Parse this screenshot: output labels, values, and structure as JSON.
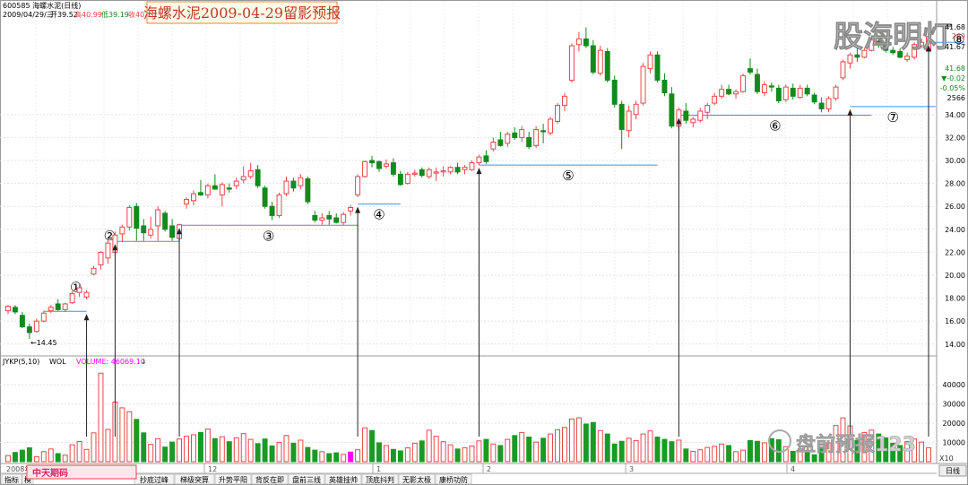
{
  "header": {
    "code_line": "600585 海螺水泥(日线)",
    "date_line": "2009/04/29/三",
    "open": "开39.52",
    "high": "高40.99",
    "low": "低39.19",
    "close": "收40.8"
  },
  "title_box": "海螺水泥2009-04-29留影预报",
  "watermark_top": "股海明灯",
  "watermark_bottom": "盘前预报123",
  "right_info": {
    "v1": "41.68",
    "v2": "249",
    "v3": "41.67",
    "v4": "41.68",
    "change": "▼-0.02",
    "pct": "-0.05%",
    "vol": "2566"
  },
  "low_label": "←14.45",
  "indicator_bar": {
    "label": "JYKP(5,10)",
    "wol": "WOL",
    "vol_label": "VOLUME: 46069.10",
    "arrow": "↓"
  },
  "time_labels": [
    "2008年",
    "12",
    "1",
    "2",
    "3",
    "4"
  ],
  "tabs": [
    "指标",
    "模",
    "抄底过峰",
    "梯级突算",
    "升势平阳",
    "背反在即",
    "盘前三线",
    "英雄挂帅",
    "顶底抖判",
    "无影太极",
    "康桥功防"
  ],
  "bottom_banner": "中天期码",
  "bottom_right_tab": "日线",
  "x10_label": "X10",
  "colors": {
    "up": "#e8464c",
    "down": "#138a1c",
    "level": "#4a90d9",
    "vol_up": "#f3a0a0",
    "vol_down": "#1a9a24",
    "highlight": "#ff00ff"
  },
  "chart_data": {
    "type": "candlestick",
    "price_axis": {
      "ticks": [
        14.0,
        16.0,
        18.0,
        20.0,
        22.0,
        24.0,
        26.0,
        28.0,
        30.0,
        32.0,
        34.0
      ],
      "ylim": [
        13.2,
        41.8
      ]
    },
    "volume_axis": {
      "ticks": [
        10000,
        20000,
        30000,
        40000
      ],
      "ylim": [
        0,
        48000
      ]
    },
    "candles": [
      {
        "o": 16.9,
        "h": 17.4,
        "l": 16.6,
        "c": 17.3
      },
      {
        "o": 17.2,
        "h": 17.4,
        "l": 16.6,
        "c": 16.8
      },
      {
        "o": 16.5,
        "h": 16.8,
        "l": 15.4,
        "c": 15.5
      },
      {
        "o": 15.5,
        "h": 15.8,
        "l": 14.45,
        "c": 15.0
      },
      {
        "o": 15.1,
        "h": 16.2,
        "l": 15.0,
        "c": 16.0
      },
      {
        "o": 16.0,
        "h": 16.9,
        "l": 15.9,
        "c": 16.7
      },
      {
        "o": 16.9,
        "h": 17.4,
        "l": 16.7,
        "c": 17.2
      },
      {
        "o": 17.5,
        "h": 17.9,
        "l": 16.9,
        "c": 17.0
      },
      {
        "o": 17.0,
        "h": 17.6,
        "l": 16.8,
        "c": 17.5
      },
      {
        "o": 17.6,
        "h": 18.6,
        "l": 17.5,
        "c": 18.4
      },
      {
        "o": 18.5,
        "h": 19.2,
        "l": 18.1,
        "c": 18.9
      },
      {
        "o": 18.1,
        "h": 18.7,
        "l": 17.9,
        "c": 18.5
      },
      {
        "o": 20.1,
        "h": 20.8,
        "l": 20.0,
        "c": 20.6
      },
      {
        "o": 20.9,
        "h": 22.1,
        "l": 20.5,
        "c": 22.0
      },
      {
        "o": 21.5,
        "h": 23.2,
        "l": 21.0,
        "c": 22.8
      },
      {
        "o": 22.0,
        "h": 23.8,
        "l": 21.7,
        "c": 23.5
      },
      {
        "o": 23.6,
        "h": 24.4,
        "l": 22.9,
        "c": 24.2
      },
      {
        "o": 24.2,
        "h": 26.1,
        "l": 23.9,
        "c": 25.9
      },
      {
        "o": 26.0,
        "h": 26.3,
        "l": 23.0,
        "c": 24.1
      },
      {
        "o": 24.3,
        "h": 24.9,
        "l": 23.0,
        "c": 23.7
      },
      {
        "o": 23.5,
        "h": 25.1,
        "l": 23.2,
        "c": 24.0
      },
      {
        "o": 24.3,
        "h": 26.0,
        "l": 23.0,
        "c": 25.7
      },
      {
        "o": 25.4,
        "h": 25.6,
        "l": 23.8,
        "c": 24.0
      },
      {
        "o": 24.3,
        "h": 24.9,
        "l": 23.0,
        "c": 23.3
      },
      {
        "o": 23.2,
        "h": 24.5,
        "l": 22.9,
        "c": 24.4
      },
      {
        "o": 26.2,
        "h": 26.8,
        "l": 25.8,
        "c": 26.6
      },
      {
        "o": 26.5,
        "h": 27.4,
        "l": 26.1,
        "c": 27.1
      },
      {
        "o": 27.2,
        "h": 28.3,
        "l": 26.9,
        "c": 27.0
      },
      {
        "o": 27.0,
        "h": 28.0,
        "l": 26.7,
        "c": 27.8
      },
      {
        "o": 27.8,
        "h": 28.8,
        "l": 27.5,
        "c": 27.5
      },
      {
        "o": 27.0,
        "h": 28.1,
        "l": 26.0,
        "c": 27.9
      },
      {
        "o": 27.6,
        "h": 28.0,
        "l": 27.2,
        "c": 27.5
      },
      {
        "o": 27.8,
        "h": 28.5,
        "l": 27.5,
        "c": 28.2
      },
      {
        "o": 28.3,
        "h": 29.5,
        "l": 28.0,
        "c": 28.6
      },
      {
        "o": 28.6,
        "h": 29.8,
        "l": 28.4,
        "c": 29.1
      },
      {
        "o": 29.2,
        "h": 29.6,
        "l": 27.6,
        "c": 27.8
      },
      {
        "o": 27.6,
        "h": 27.8,
        "l": 25.8,
        "c": 26.0
      },
      {
        "o": 26.0,
        "h": 26.4,
        "l": 24.8,
        "c": 25.2
      },
      {
        "o": 25.2,
        "h": 27.2,
        "l": 25.0,
        "c": 27.0
      },
      {
        "o": 27.1,
        "h": 28.6,
        "l": 26.9,
        "c": 28.2
      },
      {
        "o": 28.2,
        "h": 28.5,
        "l": 27.3,
        "c": 27.6
      },
      {
        "o": 27.8,
        "h": 28.8,
        "l": 27.5,
        "c": 28.5
      },
      {
        "o": 28.4,
        "h": 28.6,
        "l": 26.2,
        "c": 26.4
      },
      {
        "o": 25.2,
        "h": 25.6,
        "l": 24.6,
        "c": 24.8
      },
      {
        "o": 24.8,
        "h": 25.4,
        "l": 24.4,
        "c": 25.0
      },
      {
        "o": 25.2,
        "h": 25.6,
        "l": 24.4,
        "c": 24.9
      },
      {
        "o": 25.0,
        "h": 25.4,
        "l": 24.5,
        "c": 24.6
      },
      {
        "o": 24.6,
        "h": 25.5,
        "l": 24.4,
        "c": 25.3
      },
      {
        "o": 25.6,
        "h": 26.1,
        "l": 25.2,
        "c": 25.9
      },
      {
        "o": 27.0,
        "h": 28.8,
        "l": 26.8,
        "c": 28.6
      },
      {
        "o": 28.6,
        "h": 30.0,
        "l": 28.5,
        "c": 29.9
      },
      {
        "o": 30.0,
        "h": 30.4,
        "l": 29.4,
        "c": 29.8
      },
      {
        "o": 29.9,
        "h": 30.0,
        "l": 29.0,
        "c": 29.3
      },
      {
        "o": 29.5,
        "h": 30.1,
        "l": 29.3,
        "c": 29.7
      },
      {
        "o": 29.8,
        "h": 30.2,
        "l": 28.6,
        "c": 28.8
      },
      {
        "o": 28.8,
        "h": 29.1,
        "l": 27.8,
        "c": 27.9
      },
      {
        "o": 28.0,
        "h": 29.0,
        "l": 27.9,
        "c": 28.8
      },
      {
        "o": 28.8,
        "h": 29.2,
        "l": 28.6,
        "c": 28.9
      },
      {
        "o": 29.2,
        "h": 29.4,
        "l": 28.5,
        "c": 28.7
      },
      {
        "o": 28.6,
        "h": 29.4,
        "l": 28.4,
        "c": 29.2
      },
      {
        "o": 28.9,
        "h": 29.4,
        "l": 28.2,
        "c": 29.0
      },
      {
        "o": 29.0,
        "h": 29.5,
        "l": 28.6,
        "c": 29.1
      },
      {
        "o": 29.0,
        "h": 29.5,
        "l": 28.8,
        "c": 29.4
      },
      {
        "o": 29.4,
        "h": 29.8,
        "l": 28.8,
        "c": 29.0
      },
      {
        "o": 29.2,
        "h": 29.6,
        "l": 28.8,
        "c": 29.4
      },
      {
        "o": 29.2,
        "h": 30.0,
        "l": 29.1,
        "c": 29.8
      },
      {
        "o": 29.8,
        "h": 30.5,
        "l": 29.6,
        "c": 30.3
      },
      {
        "o": 30.4,
        "h": 30.9,
        "l": 29.7,
        "c": 29.9
      },
      {
        "o": 31.0,
        "h": 32.0,
        "l": 30.8,
        "c": 31.6
      },
      {
        "o": 31.8,
        "h": 32.5,
        "l": 31.2,
        "c": 31.3
      },
      {
        "o": 31.5,
        "h": 32.5,
        "l": 31.2,
        "c": 32.3
      },
      {
        "o": 32.4,
        "h": 32.9,
        "l": 31.8,
        "c": 32.0
      },
      {
        "o": 32.0,
        "h": 33.0,
        "l": 31.6,
        "c": 32.7
      },
      {
        "o": 32.0,
        "h": 32.5,
        "l": 31.0,
        "c": 31.2
      },
      {
        "o": 31.3,
        "h": 33.0,
        "l": 31.1,
        "c": 32.7
      },
      {
        "o": 32.6,
        "h": 33.2,
        "l": 31.5,
        "c": 32.5
      },
      {
        "o": 32.4,
        "h": 33.8,
        "l": 32.2,
        "c": 33.6
      },
      {
        "o": 33.4,
        "h": 35.0,
        "l": 33.2,
        "c": 34.8
      },
      {
        "o": 34.8,
        "h": 35.9,
        "l": 34.3,
        "c": 35.6
      },
      {
        "o": 37.0,
        "h": 40.2,
        "l": 36.8,
        "c": 40.0
      },
      {
        "o": 40.1,
        "h": 41.2,
        "l": 39.5,
        "c": 40.6
      },
      {
        "o": 40.6,
        "h": 41.6,
        "l": 39.8,
        "c": 40.0
      },
      {
        "o": 40.0,
        "h": 40.5,
        "l": 37.5,
        "c": 37.7
      },
      {
        "o": 37.6,
        "h": 40.0,
        "l": 37.4,
        "c": 39.6
      },
      {
        "o": 39.5,
        "h": 39.8,
        "l": 36.8,
        "c": 37.0
      },
      {
        "o": 37.0,
        "h": 37.4,
        "l": 34.6,
        "c": 34.9
      },
      {
        "o": 34.9,
        "h": 35.2,
        "l": 31.0,
        "c": 32.7
      },
      {
        "o": 32.6,
        "h": 34.8,
        "l": 32.0,
        "c": 34.3
      },
      {
        "o": 34.0,
        "h": 35.2,
        "l": 33.6,
        "c": 34.9
      },
      {
        "o": 35.0,
        "h": 38.5,
        "l": 34.8,
        "c": 38.2
      },
      {
        "o": 38.0,
        "h": 39.5,
        "l": 37.6,
        "c": 39.2
      },
      {
        "o": 39.2,
        "h": 39.5,
        "l": 36.8,
        "c": 37.0
      },
      {
        "o": 37.0,
        "h": 37.6,
        "l": 35.6,
        "c": 35.9
      },
      {
        "o": 35.8,
        "h": 36.4,
        "l": 32.8,
        "c": 33.0
      },
      {
        "o": 33.0,
        "h": 34.6,
        "l": 32.6,
        "c": 34.4
      },
      {
        "o": 34.3,
        "h": 35.0,
        "l": 33.2,
        "c": 33.5
      },
      {
        "o": 33.3,
        "h": 33.8,
        "l": 32.9,
        "c": 33.6
      },
      {
        "o": 33.5,
        "h": 34.6,
        "l": 33.3,
        "c": 34.3
      },
      {
        "o": 34.2,
        "h": 35.0,
        "l": 33.6,
        "c": 34.8
      },
      {
        "o": 35.0,
        "h": 35.9,
        "l": 34.8,
        "c": 35.6
      },
      {
        "o": 35.6,
        "h": 36.6,
        "l": 35.4,
        "c": 36.2
      },
      {
        "o": 36.2,
        "h": 36.6,
        "l": 35.7,
        "c": 35.8
      },
      {
        "o": 35.8,
        "h": 36.2,
        "l": 35.4,
        "c": 36.0
      },
      {
        "o": 36.0,
        "h": 37.6,
        "l": 35.9,
        "c": 37.4
      },
      {
        "o": 38.0,
        "h": 38.9,
        "l": 37.5,
        "c": 37.7
      },
      {
        "o": 37.5,
        "h": 38.0,
        "l": 35.8,
        "c": 36.0
      },
      {
        "o": 35.9,
        "h": 36.9,
        "l": 35.6,
        "c": 36.6
      },
      {
        "o": 36.5,
        "h": 36.8,
        "l": 36.0,
        "c": 36.4
      },
      {
        "o": 36.3,
        "h": 36.6,
        "l": 35.0,
        "c": 35.2
      },
      {
        "o": 35.3,
        "h": 36.6,
        "l": 35.1,
        "c": 36.4
      },
      {
        "o": 36.3,
        "h": 36.7,
        "l": 35.3,
        "c": 35.6
      },
      {
        "o": 35.5,
        "h": 36.6,
        "l": 35.4,
        "c": 36.3
      },
      {
        "o": 36.3,
        "h": 36.6,
        "l": 35.6,
        "c": 35.8
      },
      {
        "o": 35.7,
        "h": 35.9,
        "l": 34.9,
        "c": 35.1
      },
      {
        "o": 35.0,
        "h": 35.5,
        "l": 34.2,
        "c": 34.5
      },
      {
        "o": 34.5,
        "h": 35.6,
        "l": 34.2,
        "c": 35.4
      },
      {
        "o": 35.4,
        "h": 36.6,
        "l": 35.2,
        "c": 36.4
      },
      {
        "o": 37.2,
        "h": 38.8,
        "l": 37.0,
        "c": 38.6
      },
      {
        "o": 38.5,
        "h": 39.4,
        "l": 38.0,
        "c": 39.2
      },
      {
        "o": 39.2,
        "h": 40.0,
        "l": 38.6,
        "c": 39.0
      },
      {
        "o": 39.0,
        "h": 39.8,
        "l": 38.9,
        "c": 39.6
      },
      {
        "o": 39.6,
        "h": 40.8,
        "l": 39.5,
        "c": 40.5
      },
      {
        "o": 40.4,
        "h": 40.7,
        "l": 39.8,
        "c": 40.1
      },
      {
        "o": 40.2,
        "h": 40.6,
        "l": 39.4,
        "c": 39.6
      },
      {
        "o": 39.6,
        "h": 39.9,
        "l": 39.2,
        "c": 39.4
      },
      {
        "o": 39.5,
        "h": 39.8,
        "l": 38.9,
        "c": 39.0
      },
      {
        "o": 38.8,
        "h": 39.4,
        "l": 38.6,
        "c": 39.1
      },
      {
        "o": 39.0,
        "h": 40.3,
        "l": 38.8,
        "c": 40.1
      },
      {
        "o": 40.0,
        "h": 40.6,
        "l": 39.8,
        "c": 40.3
      },
      {
        "o": 39.52,
        "h": 40.99,
        "l": 39.19,
        "c": 40.8
      }
    ],
    "volume": [
      3200,
      4800,
      6000,
      7200,
      2600,
      5200,
      6600,
      4200,
      3400,
      8800,
      10500,
      6400,
      15000,
      46000,
      16800,
      31000,
      28000,
      26000,
      22000,
      15000,
      9000,
      12000,
      7600,
      10200,
      11800,
      13200,
      14000,
      15200,
      17000,
      12000,
      13000,
      10400,
      12400,
      14600,
      11600,
      9400,
      11800,
      8200,
      10000,
      13600,
      9600,
      11200,
      7400,
      6000,
      5200,
      4200,
      4600,
      3800,
      5000,
      6200,
      17600,
      16200,
      9800,
      8400,
      6400,
      5600,
      7200,
      9600,
      10800,
      16400,
      13200,
      10400,
      8800,
      6600,
      7200,
      8200,
      10800,
      11600,
      9200,
      8400,
      11600,
      13600,
      15200,
      12800,
      10200,
      12200,
      14400,
      16600,
      17800,
      22200,
      22800,
      19600,
      20400,
      16200,
      14400,
      9200,
      10600,
      12200,
      11000,
      14400,
      16000,
      12800,
      11600,
      10400,
      11200,
      6600,
      5400,
      6200,
      7400,
      8000,
      9200,
      8400,
      5200,
      6000,
      11000,
      10600,
      9800,
      12000,
      11400,
      7800,
      5400,
      6600,
      4800,
      3600,
      6800,
      9800,
      18800,
      22800,
      18600,
      11000,
      15200,
      16400,
      14400,
      12400,
      9600,
      8400,
      10400,
      11800,
      10200,
      7200
    ],
    "vol_highlight_index": 48,
    "support_levels": [
      {
        "label": "①",
        "price": 16.85
      },
      {
        "label": "②",
        "price": 22.95
      },
      {
        "label": "③",
        "price": 24.35
      },
      {
        "label": "④",
        "price": 26.2
      },
      {
        "label": "⑤",
        "price": 29.6
      },
      {
        "label": "⑥",
        "price": 33.95
      },
      {
        "label": "⑦",
        "price": 34.7
      },
      {
        "label": "⑧",
        "price": 40.3
      }
    ]
  }
}
